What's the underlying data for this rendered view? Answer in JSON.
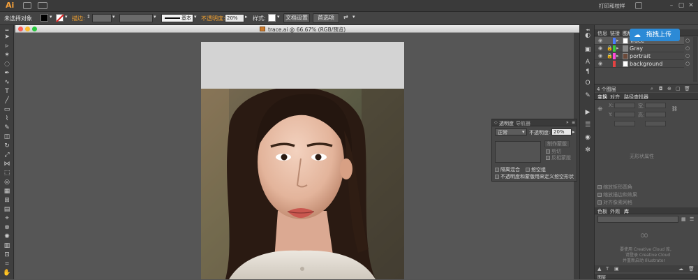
{
  "app": {
    "logo": "Ai"
  },
  "menubar": {
    "workspace_label": "打印和校样"
  },
  "control_bar": {
    "selection_label": "未选择对象",
    "stroke_label": "描边:",
    "stroke_style": "基本",
    "opacity_label": "不透明度:",
    "opacity_value": "20%",
    "style_label": "样式:",
    "doc_setup_button": "文档设置",
    "preferences_button": "首选项"
  },
  "document": {
    "title": "trace.ai @ 66.67% (RGB/预览)"
  },
  "transparency_panel": {
    "tab_transparency": "透明度",
    "tab_navigator": "导航器",
    "blend_mode": "正常",
    "opacity_label": "不透明度:",
    "opacity_value": "20%",
    "make_mask_button": "制作蒙版",
    "clip_label": "剪切",
    "invert_mask_label": "反相蒙版",
    "isolate_blending_label": "隔离混合",
    "knockout_group_label": "挖空组",
    "opacity_mask_label": "不透明度和蒙版用来定义挖空形状"
  },
  "layers_panel": {
    "tab_info": "信息",
    "tab_links": "链接",
    "tab_layers": "图层",
    "layers": [
      {
        "name": "Trace",
        "color": "#4a7bff"
      },
      {
        "name": "Gray",
        "color": "#39c93a"
      },
      {
        "name": "portrait",
        "color": "#ff4ad8"
      },
      {
        "name": "background",
        "color": "#e54242"
      }
    ],
    "layer_count": "4 个图层"
  },
  "cloud_button": {
    "label": "拖拽上传"
  },
  "transform_panel": {
    "tab_transform": "变换",
    "tab_align": "对齐",
    "tab_pathfinder": "路径查找器",
    "x_label": "X:",
    "y_label": "Y:",
    "w_label": "宽:",
    "h_label": "高:",
    "no_shape_props": "无形状属性",
    "scale_corners": "缩放矩形圆角",
    "scale_strokes": "缩放描边和效果",
    "align_pixel_grid": "对齐像素网格"
  },
  "libraries_panel": {
    "tab_swatches": "色板",
    "tab_brushes": "外观",
    "tab_libraries": "库",
    "cloud_line1": "要使用 Creative Cloud 库,",
    "cloud_line2": "请登录 Creative Cloud",
    "cloud_line3": "并重新启动 Illustrator"
  },
  "bottom_tab": {
    "label": "图层"
  },
  "colors": {
    "accent_orange": "#f0a030",
    "cloud_blue": "#2c8ad6"
  }
}
